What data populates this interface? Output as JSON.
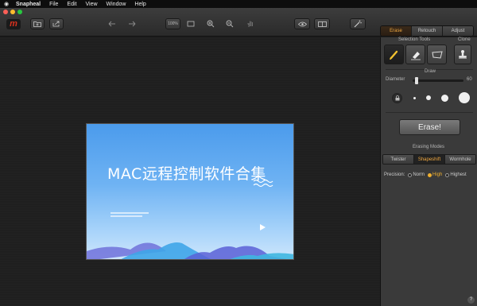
{
  "menubar": {
    "apple_icon": "apple-icon",
    "items": [
      "Snapheal",
      "File",
      "Edit",
      "View",
      "Window",
      "Help"
    ]
  },
  "toolbar": {
    "logo_letter": "m",
    "icons": [
      "open-folder-icon",
      "share-icon",
      "undo-icon",
      "redo-icon",
      "actual-size-icon",
      "fit-icon",
      "zoom-in-icon",
      "zoom-out-icon",
      "hand-icon",
      "preview-eye-icon",
      "compare-icon",
      "magic-wand-icon"
    ],
    "actual_size_label": "100%",
    "colors": {
      "close": "#fc5f57",
      "minimize": "#fdbc2e",
      "zoom": "#28c840",
      "accent": "#f0a840"
    }
  },
  "mode_tabs": [
    {
      "label": "Erase",
      "active": true
    },
    {
      "label": "Retouch",
      "active": false
    },
    {
      "label": "Adjust",
      "active": false
    }
  ],
  "canvas": {
    "image_title": "MAC远程控制软件合集",
    "image_colors": {
      "sky_top": "#4b9bec",
      "sky_bottom": "#cde6fc"
    }
  },
  "panel": {
    "selection_tools_label": "Selection Tools",
    "clone_label": "Clone",
    "selection_tools": [
      "brush-icon",
      "eraser-icon",
      "lasso-icon"
    ],
    "clone_tool": "clone-stamp-icon",
    "draw_label": "Draw",
    "diameter_label": "Diameter",
    "diameter_value": "60",
    "diameter_fraction": 0.05,
    "brush_sizes": [
      "small",
      "medium",
      "large",
      "xlarge"
    ],
    "erase_button": "Erase!",
    "erasing_modes_label": "Erasing Modes",
    "erasing_modes": [
      {
        "label": "Twister",
        "active": false
      },
      {
        "label": "Shapeshift",
        "active": true
      },
      {
        "label": "Wormhole",
        "active": false
      }
    ],
    "precision_label": "Precision:",
    "precision_options": [
      {
        "label": "Norm",
        "selected": false
      },
      {
        "label": "High",
        "selected": true
      },
      {
        "label": "Highest",
        "selected": false
      }
    ],
    "help_label": "?"
  }
}
